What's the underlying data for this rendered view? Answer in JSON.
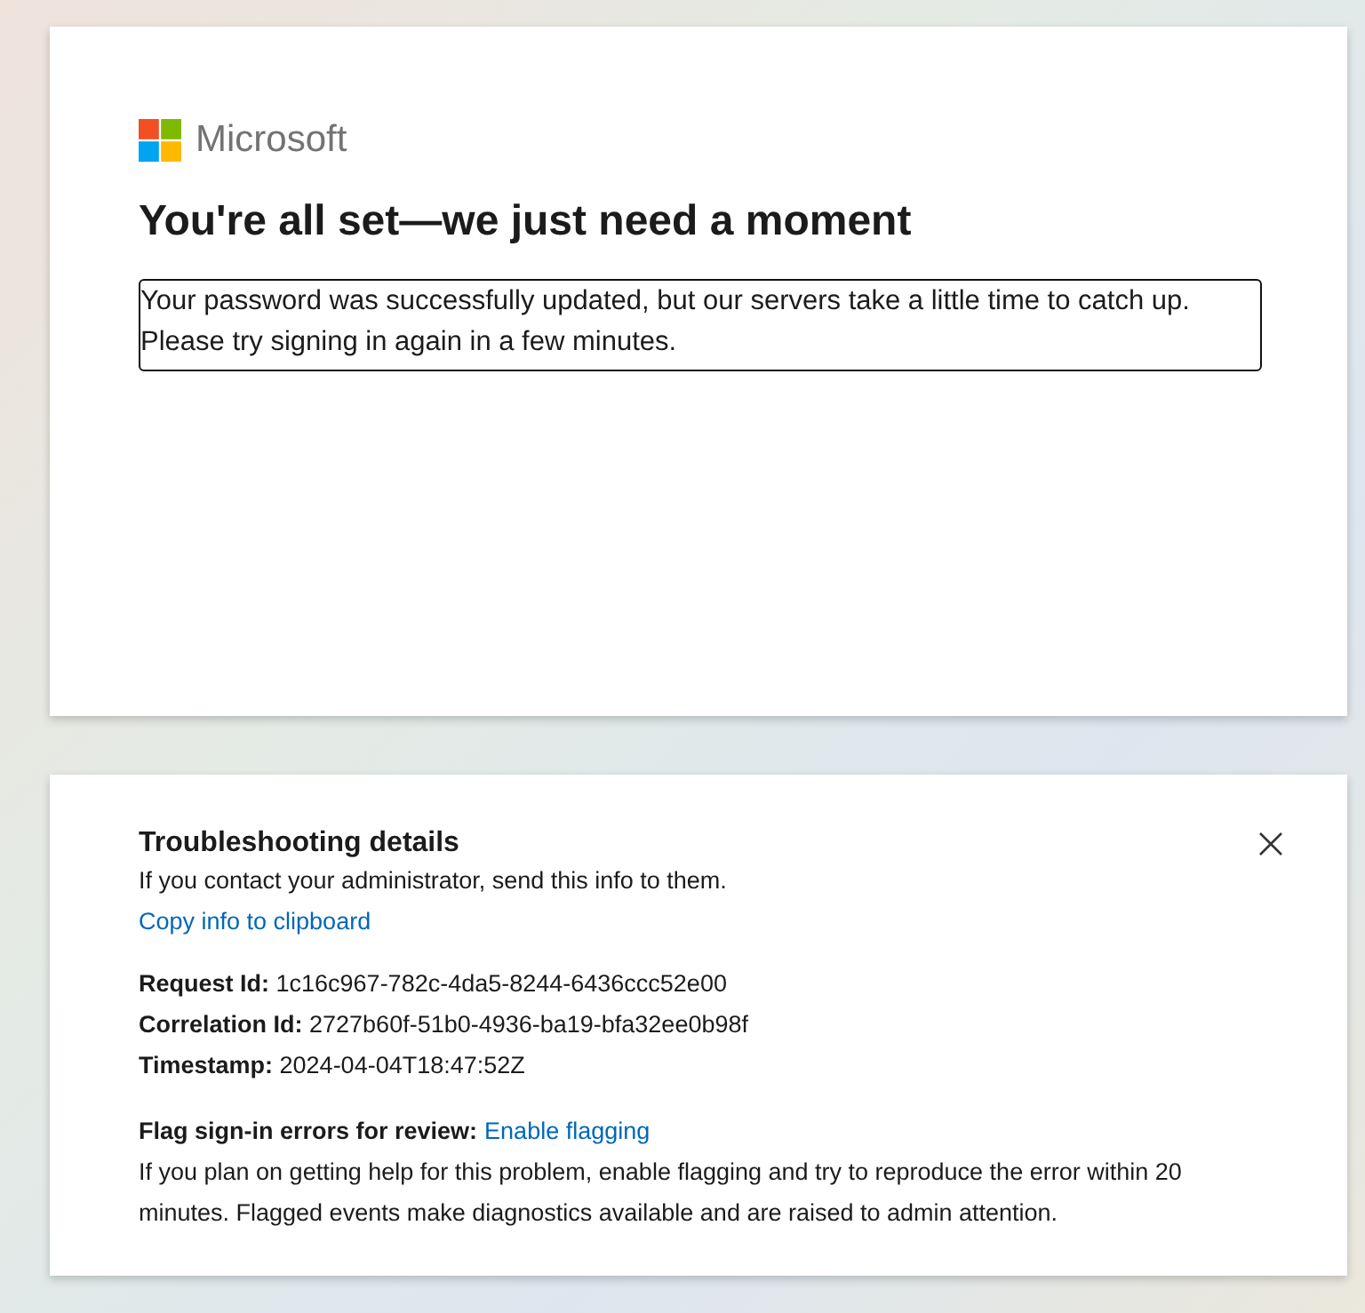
{
  "brand": {
    "name": "Microsoft"
  },
  "heading": "You're all set—we just need a moment",
  "message": "Your password was successfully updated, but our servers take a little time to catch up. Please try signing in again in a few minutes.",
  "troubleshooting": {
    "title": "Troubleshooting details",
    "intro": "If you contact your administrator, send this info to them.",
    "copy_link": "Copy info to clipboard",
    "fields": [
      {
        "label": "Request Id:",
        "value": "1c16c967-782c-4da5-8244-6436ccc52e00"
      },
      {
        "label": "Correlation Id:",
        "value": "2727b60f-51b0-4936-ba19-bfa32ee0b98f"
      },
      {
        "label": "Timestamp:",
        "value": "2024-04-04T18:47:52Z"
      }
    ],
    "flag_label": "Flag sign-in errors for review:",
    "flag_link": "Enable flagging",
    "flag_note": "If you plan on getting help for this problem, enable flagging and try to reproduce the error within 20 minutes. Flagged events make diagnostics available and are raised to admin attention."
  }
}
